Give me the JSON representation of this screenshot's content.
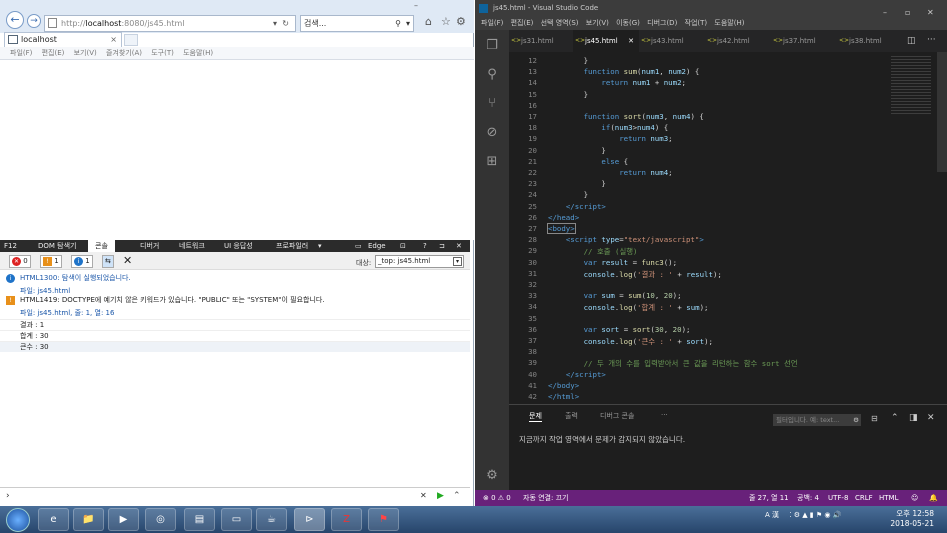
{
  "ie": {
    "address": "http://",
    "address_host": "localhost",
    "address_rest": ":8080/js45.html",
    "search_placeholder": "검색...",
    "tab_title": "localhost",
    "menu": [
      "파일(F)",
      "편집(E)",
      "보기(V)",
      "즐겨찾기(A)",
      "도구(T)",
      "도움말(H)"
    ],
    "devtools_tabs": [
      "F12",
      "DOM 탐색기",
      "콘솔",
      "디버거",
      "네트워크",
      "UI 응답성",
      "프로파일러"
    ],
    "emulation": "Edge",
    "error_count": "0",
    "warning_count": "1",
    "info_count": "1",
    "target_label": "대상:",
    "target_value": "_top: js45.html",
    "console": [
      {
        "type": "info",
        "text": "HTML1300: 탐색이 실행되었습니다.",
        "sub": "파일: js45.html"
      },
      {
        "type": "warning",
        "text": "HTML1419: DOCTYPE에 예기치 않은 키워드가 있습니다. \"PUBLIC\" 또는 \"SYSTEM\"이 필요합니다.",
        "sub": "파일: js45.html, 줄: 1, 열: 16"
      },
      {
        "type": "log",
        "text": "결과 : 1"
      },
      {
        "type": "log",
        "text": "합계 : 30"
      },
      {
        "type": "log",
        "text": "큰수 : 30"
      }
    ]
  },
  "vscode": {
    "title": "js45.html - Visual Studio Code",
    "menu": [
      "파일(F)",
      "편집(E)",
      "선택 영역(S)",
      "보기(V)",
      "이동(G)",
      "디버그(D)",
      "작업(T)",
      "도움말(H)"
    ],
    "tabs": [
      {
        "name": "js31.html",
        "active": false
      },
      {
        "name": "js45.html",
        "active": true
      },
      {
        "name": "js43.html",
        "active": false
      },
      {
        "name": "js42.html",
        "active": false
      },
      {
        "name": "js37.html",
        "active": false
      },
      {
        "name": "js38.html",
        "active": false
      }
    ],
    "lines": [
      {
        "n": "12",
        "html": "        <span class='pl'>}</span>"
      },
      {
        "n": "13",
        "html": "        <span class='kw'>function</span> <span class='fn'>sum</span><span class='pl'>(</span><span class='vr'>num1</span><span class='pl'>, </span><span class='vr'>num2</span><span class='pl'>) {</span>"
      },
      {
        "n": "14",
        "html": "            <span class='kw'>return</span> <span class='vr'>num1</span> <span class='pl'>+</span> <span class='vr'>num2</span><span class='pl'>;</span>"
      },
      {
        "n": "15",
        "html": "        <span class='pl'>}</span>"
      },
      {
        "n": "16",
        "html": ""
      },
      {
        "n": "17",
        "html": "        <span class='kw'>function</span> <span class='fn'>sort</span><span class='pl'>(</span><span class='vr'>num3</span><span class='pl'>, </span><span class='vr'>num4</span><span class='pl'>) {</span>"
      },
      {
        "n": "18",
        "html": "            <span class='kw'>if</span><span class='pl'>(</span><span class='vr'>num3</span><span class='pl'>&gt;</span><span class='vr'>num4</span><span class='pl'>) {</span>"
      },
      {
        "n": "19",
        "html": "                <span class='kw'>return</span> <span class='vr'>num3</span><span class='pl'>;</span>"
      },
      {
        "n": "20",
        "html": "            <span class='pl'>}</span>"
      },
      {
        "n": "21",
        "html": "            <span class='kw'>else</span> <span class='pl'>{</span>"
      },
      {
        "n": "22",
        "html": "                <span class='kw'>return</span> <span class='vr'>num4</span><span class='pl'>;</span>"
      },
      {
        "n": "23",
        "html": "            <span class='pl'>}</span>"
      },
      {
        "n": "24",
        "html": "        <span class='pl'>}</span>"
      },
      {
        "n": "25",
        "html": "    <span class='tg'>&lt;/script&gt;</span>"
      },
      {
        "n": "26",
        "html": "<span class='tg'>&lt;/head&gt;</span>"
      },
      {
        "n": "27",
        "html": "<span class='tg' style='outline:1px solid #888'>&lt;body&gt;</span>"
      },
      {
        "n": "28",
        "html": "    <span class='tg'>&lt;script</span> <span class='at'>type</span><span class='pl'>=</span><span class='st'>\"text/javascript\"</span><span class='tg'>&gt;</span>"
      },
      {
        "n": "29",
        "html": "        <span class='cm'>// 호출 (실행)</span>"
      },
      {
        "n": "30",
        "html": "        <span class='kw'>var</span> <span class='vr'>result</span> <span class='pl'>=</span> <span class='fn'>func3</span><span class='pl'>();</span>"
      },
      {
        "n": "31",
        "html": "        <span class='vr'>console</span><span class='pl'>.</span><span class='fn'>log</span><span class='pl'>(</span><span class='st'>'결과 : '</span> <span class='pl'>+</span> <span class='vr'>result</span><span class='pl'>);</span>"
      },
      {
        "n": "32",
        "html": ""
      },
      {
        "n": "33",
        "html": "        <span class='kw'>var</span> <span class='vr'>sum</span> <span class='pl'>=</span> <span class='fn'>sum</span><span class='pl'>(</span><span class='nm'>10</span><span class='pl'>, </span><span class='nm'>20</span><span class='pl'>);</span>"
      },
      {
        "n": "34",
        "html": "        <span class='vr'>console</span><span class='pl'>.</span><span class='fn'>log</span><span class='pl'>(</span><span class='st'>'합계 : '</span> <span class='pl'>+</span> <span class='vr'>sum</span><span class='pl'>);</span>"
      },
      {
        "n": "35",
        "html": ""
      },
      {
        "n": "36",
        "html": "        <span class='kw'>var</span> <span class='vr'>sort</span> <span class='pl'>=</span> <span class='fn'>sort</span><span class='pl'>(</span><span class='nm'>30</span><span class='pl'>, </span><span class='nm'>20</span><span class='pl'>);</span>"
      },
      {
        "n": "37",
        "html": "        <span class='vr'>console</span><span class='pl'>.</span><span class='fn'>log</span><span class='pl'>(</span><span class='st'>'큰수 : '</span> <span class='pl'>+</span> <span class='vr'>sort</span><span class='pl'>);</span>"
      },
      {
        "n": "38",
        "html": ""
      },
      {
        "n": "39",
        "html": "        <span class='cm'>// 두 개의 수를 입력받아서 큰 값을 리턴하는 함수 sort 선언</span>"
      },
      {
        "n": "40",
        "html": "    <span class='tg'>&lt;/script&gt;</span>"
      },
      {
        "n": "41",
        "html": "<span class='tg'>&lt;/body&gt;</span>"
      },
      {
        "n": "42",
        "html": "<span class='tg'>&lt;/html&gt;</span>"
      }
    ],
    "panel_tabs": [
      "문제",
      "출력",
      "디버그 콘솔",
      "···"
    ],
    "filter_placeholder": "필터입니다. 예: text...",
    "problems_message": "지금까지 작업 영역에서 문제가 감지되지 않았습니다.",
    "status_left": "⊗ 0 ⚠ 0",
    "status_live": "자동 연결: 끄기",
    "status_pos": "줄 27, 열 11",
    "status_spaces": "공백: 4",
    "status_encoding": "UTF-8",
    "status_eol": "CRLF",
    "status_lang": "HTML"
  },
  "taskbar": {
    "apps": [
      "e",
      "📁",
      "▶",
      "◎",
      "▤",
      "▭",
      "☕",
      "⊳",
      "Z",
      "⚑"
    ],
    "tray_text": "A 漢",
    "clock_ampm": "오후 12:58",
    "clock_date": "2018-05-21"
  },
  "colors": {
    "vscode_status": "#68217a",
    "vscode_bg": "#1e1e1e",
    "ie_chrome": "#dfe9f5"
  }
}
